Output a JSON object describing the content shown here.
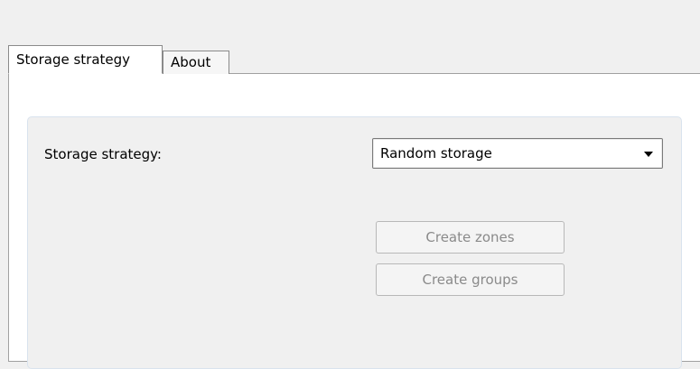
{
  "tabs": [
    {
      "label": "Storage strategy",
      "active": true
    },
    {
      "label": "About",
      "active": false
    }
  ],
  "form": {
    "storage_strategy_label": "Storage strategy:",
    "storage_strategy_value": "Random storage",
    "create_zones_label": "Create zones",
    "create_groups_label": "Create groups"
  }
}
